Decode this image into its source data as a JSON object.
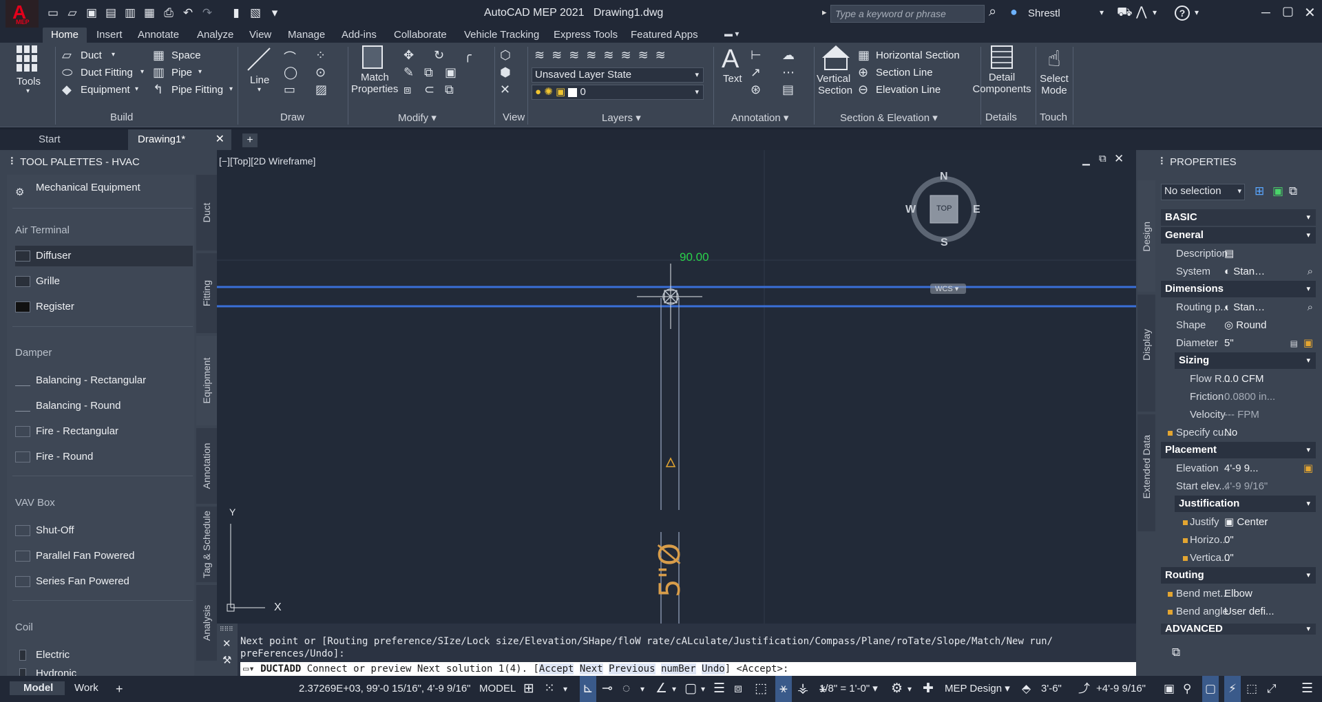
{
  "app": {
    "logo_letter": "A",
    "logo_sub": "MEP",
    "title": "AutoCAD MEP 2021",
    "file": "Drawing1.dwg"
  },
  "search": {
    "placeholder": "Type a keyword or phrase"
  },
  "user": {
    "name": "Shrestl"
  },
  "ribbon_tabs": [
    "Home",
    "Insert",
    "Annotate",
    "Analyze",
    "View",
    "Manage",
    "Add-ins",
    "Collaborate",
    "Vehicle Tracking",
    "Express Tools",
    "Featured Apps"
  ],
  "ribbon": {
    "tools": "Tools",
    "build": {
      "duct": "Duct",
      "duct_fitting": "Duct Fitting",
      "equipment": "Equipment",
      "space": "Space",
      "pipe": "Pipe",
      "pipe_fitting": "Pipe Fitting",
      "panel": "Build"
    },
    "draw": {
      "line": "Line",
      "panel": "Draw"
    },
    "modify": {
      "match": "Match",
      "properties": "Properties",
      "panel": "Modify"
    },
    "view": {
      "panel": "View"
    },
    "layers": {
      "state": "Unsaved Layer State",
      "layer": "0",
      "panel": "Layers"
    },
    "annotation": {
      "text": "Text",
      "panel": "Annotation"
    },
    "section": {
      "vertical": "Vertical",
      "section": "Section",
      "horizontal": "Horizontal Section",
      "section_line": "Section Line",
      "elevation_line": "Elevation Line",
      "panel": "Section & Elevation"
    },
    "details": {
      "detail": "Detail",
      "components": "Components",
      "panel": "Details"
    },
    "touch": {
      "select": "Select",
      "mode": "Mode",
      "panel": "Touch"
    }
  },
  "doc_tabs": [
    "Start",
    "Drawing1*"
  ],
  "tool_palette": {
    "title": "TOOL PALETTES - HVAC",
    "side_tabs": [
      "Duct",
      "Fitting",
      "Equipment",
      "Annotation",
      "Tag & Schedule",
      "Analysis"
    ],
    "mech_equipment": "Mechanical Equipment",
    "air_terminal": {
      "heading": "Air Terminal",
      "items": [
        "Diffuser",
        "Grille",
        "Register"
      ]
    },
    "damper": {
      "heading": "Damper",
      "items": [
        "Balancing - Rectangular",
        "Balancing - Round",
        "Fire - Rectangular",
        "Fire - Round"
      ]
    },
    "vav": {
      "heading": "VAV Box",
      "items": [
        "Shut-Off",
        "Parallel Fan Powered",
        "Series Fan Powered"
      ]
    },
    "coil": {
      "heading": "Coil",
      "items": [
        "Electric",
        "Hydronic"
      ]
    }
  },
  "viewport": {
    "label": "[−][Top][2D Wireframe]",
    "angle": "90.00",
    "viewcube": {
      "n": "N",
      "s": "S",
      "e": "E",
      "w": "W",
      "top": "TOP",
      "wcs": "WCS"
    },
    "ucs": {
      "x": "X",
      "y": "Y"
    }
  },
  "properties": {
    "title": "PROPERTIES",
    "selection": "No selection",
    "side_tabs": [
      "Design",
      "Display",
      "Extended Data"
    ],
    "basic": "BASIC",
    "general": "General",
    "description": "Description",
    "system": {
      "label": "System",
      "value": "Stan…"
    },
    "dimensions": "Dimensions",
    "routing_pref": {
      "label": "Routing p...",
      "value": "Stan…"
    },
    "shape": {
      "label": "Shape",
      "value": "Round"
    },
    "diameter": {
      "label": "Diameter",
      "value": "5\""
    },
    "sizing": "Sizing",
    "flow": {
      "label": "Flow R...",
      "value": "0.0 CFM"
    },
    "friction": {
      "label": "Friction",
      "value": "0.0800 in..."
    },
    "velocity": {
      "label": "Velocity",
      "value": "--- FPM"
    },
    "specify": {
      "label": "Specify cu...",
      "value": "No"
    },
    "placement": "Placement",
    "elevation": {
      "label": "Elevation",
      "value": "4'-9 9..."
    },
    "start_elev": {
      "label": "Start elev...",
      "value": "4'-9 9/16\""
    },
    "justification": "Justification",
    "justify": {
      "label": "Justify",
      "value": "Center"
    },
    "horiz": {
      "label": "Horizo...",
      "value": "0\""
    },
    "vert": {
      "label": "Vertica...",
      "value": "0\""
    },
    "routing": "Routing",
    "bend_method": {
      "label": "Bend met...",
      "value": "Elbow"
    },
    "bend_angle": {
      "label": "Bend angle",
      "value": "User defi..."
    },
    "advanced": "ADVANCED"
  },
  "command": {
    "line1": "Next point or [Routing preference/SIze/Lock size/Elevation/SHape/floW rate/cALculate/Justification/Compass/Plane/roTate/Slope/Match/New run/",
    "line2": "preFerences/Undo]:",
    "prefix": "DUCTADD",
    "prompt": "Connect or preview Next solution 1(4). [",
    "opt1": "Accept",
    "opt2": "Next",
    "opt3": "Previous",
    "opt4": "numBer",
    "opt5": "Undo",
    "suffix": "] <Accept>:"
  },
  "status": {
    "model_tab": "Model",
    "work_tab": "Work",
    "coords": "2.37269E+03, 99'-0 15/16\", 4'-9 9/16\"",
    "model": "MODEL",
    "scale": "1/8\" = 1'-0\"",
    "workspace": "MEP Design",
    "cut": "3'-6\"",
    "elevation": "+4'-9 9/16\""
  },
  "colors": {
    "duct_blue": "#3a6fd8",
    "annotation_orange": "#d89d4a",
    "dim_green": "#2ad24b"
  }
}
